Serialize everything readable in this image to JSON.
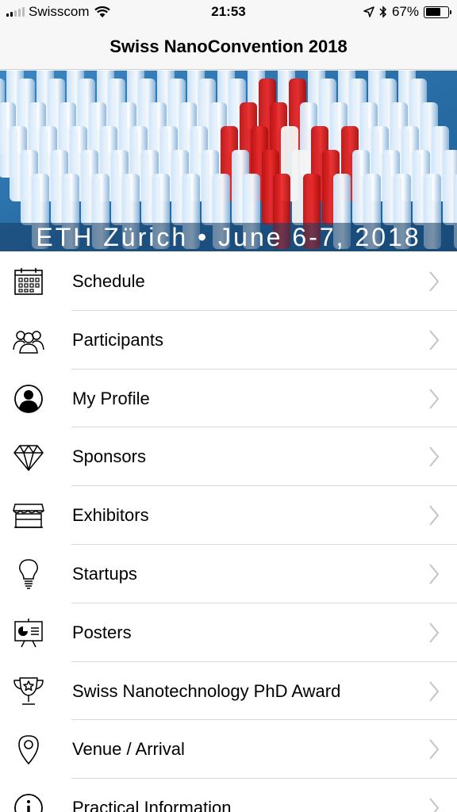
{
  "status_bar": {
    "carrier": "Swisscom",
    "time": "21:53",
    "battery_percent": "67%",
    "battery_level": 0.67
  },
  "nav": {
    "title": "Swiss NanoConvention 2018"
  },
  "banner": {
    "caption": "ETH Zürich • June 6-7, 2018"
  },
  "menu": {
    "items": [
      {
        "label": "Schedule",
        "icon": "calendar-icon"
      },
      {
        "label": "Participants",
        "icon": "people-icon"
      },
      {
        "label": "My Profile",
        "icon": "profile-icon"
      },
      {
        "label": "Sponsors",
        "icon": "diamond-icon"
      },
      {
        "label": "Exhibitors",
        "icon": "storefront-icon"
      },
      {
        "label": "Startups",
        "icon": "lightbulb-icon"
      },
      {
        "label": "Posters",
        "icon": "poster-board-icon"
      },
      {
        "label": "Swiss Nanotechnology PhD Award",
        "icon": "trophy-icon"
      },
      {
        "label": "Venue / Arrival",
        "icon": "map-pin-icon"
      },
      {
        "label": "Practical Information",
        "icon": "info-icon"
      }
    ]
  }
}
